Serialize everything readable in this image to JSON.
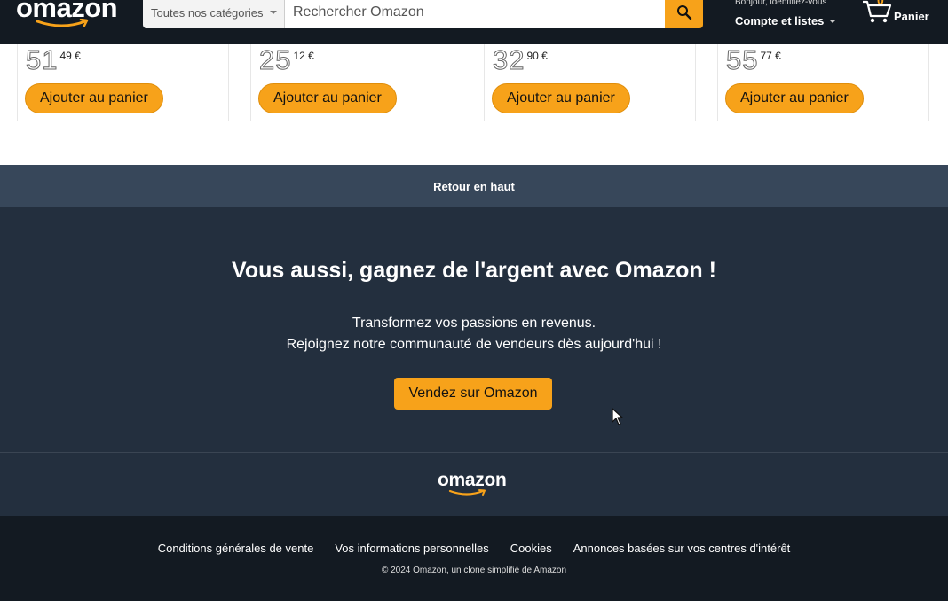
{
  "header": {
    "logo_text": "omazon",
    "search": {
      "category": "Toutes nos catégories",
      "placeholder": "Rechercher Omazon",
      "value": ""
    },
    "account": {
      "greeting": "Bonjour, identifiez-vous",
      "label": "Compte et listes"
    },
    "cart": {
      "count": "0",
      "label": "Panier"
    }
  },
  "products": [
    {
      "price_int": "51",
      "price_frac": "49 €",
      "button": "Ajouter au panier"
    },
    {
      "price_int": "25",
      "price_frac": "12 €",
      "button": "Ajouter au panier"
    },
    {
      "price_int": "32",
      "price_frac": "90 €",
      "button": "Ajouter au panier"
    },
    {
      "price_int": "55",
      "price_frac": "77 €",
      "button": "Ajouter au panier"
    }
  ],
  "back_to_top": "Retour en haut",
  "sell": {
    "title": "Vous aussi, gagnez de l'argent avec Omazon !",
    "line1": "Transformez vos passions en revenus.",
    "line2": "Rejoignez notre communauté de vendeurs dès aujourd'hui !",
    "button": "Vendez sur Omazon"
  },
  "footer": {
    "logo_text": "omazon",
    "links": [
      "Conditions générales de vente",
      "Vos informations personnelles",
      "Cookies",
      "Annonces basées sur vos centres d'intérêt"
    ],
    "copyright": "© 2024 Omazon, un clone simplifié de Amazon"
  },
  "colors": {
    "header_bg": "#131a22",
    "accent": "#f7a21a",
    "back_to_top_bg": "#37475a",
    "section_bg": "#232f3e"
  }
}
